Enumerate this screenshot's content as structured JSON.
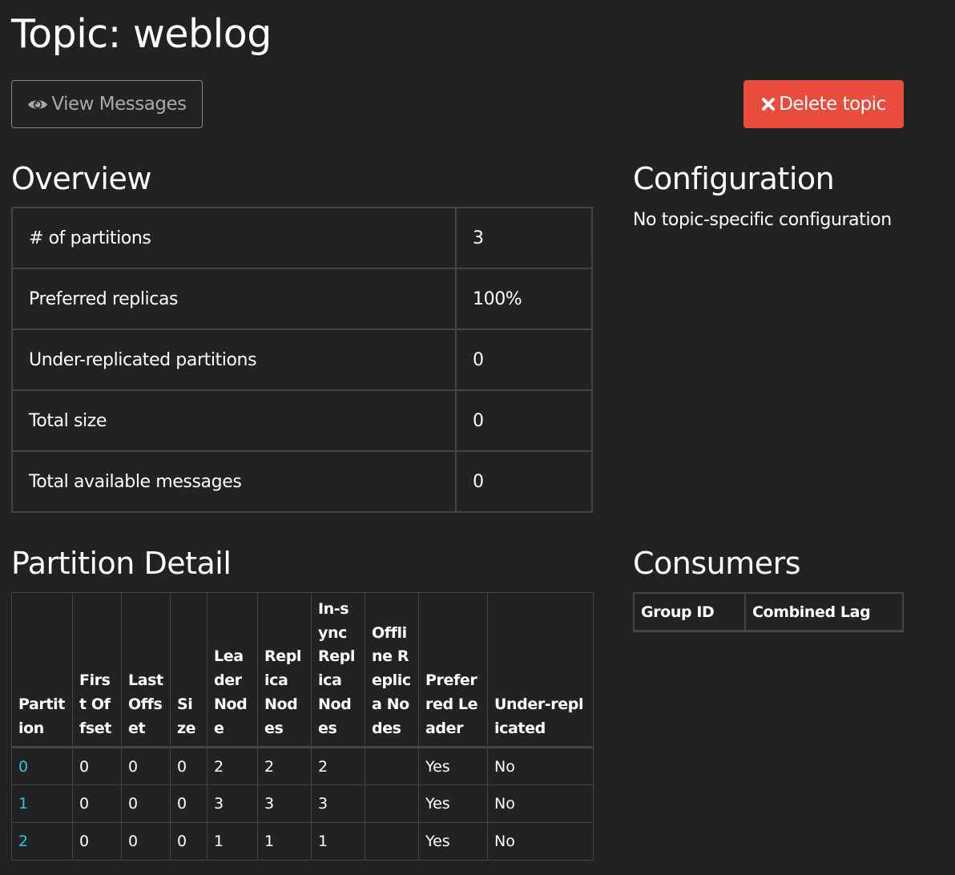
{
  "page": {
    "title": "Topic: weblog"
  },
  "actions": {
    "view_messages_label": "View Messages",
    "delete_topic_label": "Delete topic"
  },
  "overview": {
    "heading": "Overview",
    "rows": [
      {
        "label": "# of partitions",
        "value": "3"
      },
      {
        "label": "Preferred replicas",
        "value": "100%"
      },
      {
        "label": "Under-replicated partitions",
        "value": "0"
      },
      {
        "label": "Total size",
        "value": "0"
      },
      {
        "label": "Total available messages",
        "value": "0"
      }
    ]
  },
  "configuration": {
    "heading": "Configuration",
    "text": "No topic-specific configuration"
  },
  "partition_detail": {
    "heading": "Partition Detail",
    "columns": [
      "Partition",
      "First Offset",
      "Last Offset",
      "Size",
      "Leader Node",
      "Replica Nodes",
      "In-sync Replica Nodes",
      "Offline Replica Nodes",
      "Preferred Leader",
      "Under-replicated"
    ],
    "rows": [
      [
        "0",
        "0",
        "0",
        "0",
        "2",
        "2",
        "2",
        "",
        "Yes",
        "No"
      ],
      [
        "1",
        "0",
        "0",
        "0",
        "3",
        "3",
        "3",
        "",
        "Yes",
        "No"
      ],
      [
        "2",
        "0",
        "0",
        "0",
        "1",
        "1",
        "1",
        "",
        "Yes",
        "No"
      ]
    ]
  },
  "consumers": {
    "heading": "Consumers",
    "columns": [
      "Group ID",
      "Combined Lag"
    ]
  },
  "colors": {
    "background": "#222222",
    "text": "#ffffff",
    "link": "#2fc4e6",
    "danger": "#e74c3c",
    "border": "#444444"
  }
}
